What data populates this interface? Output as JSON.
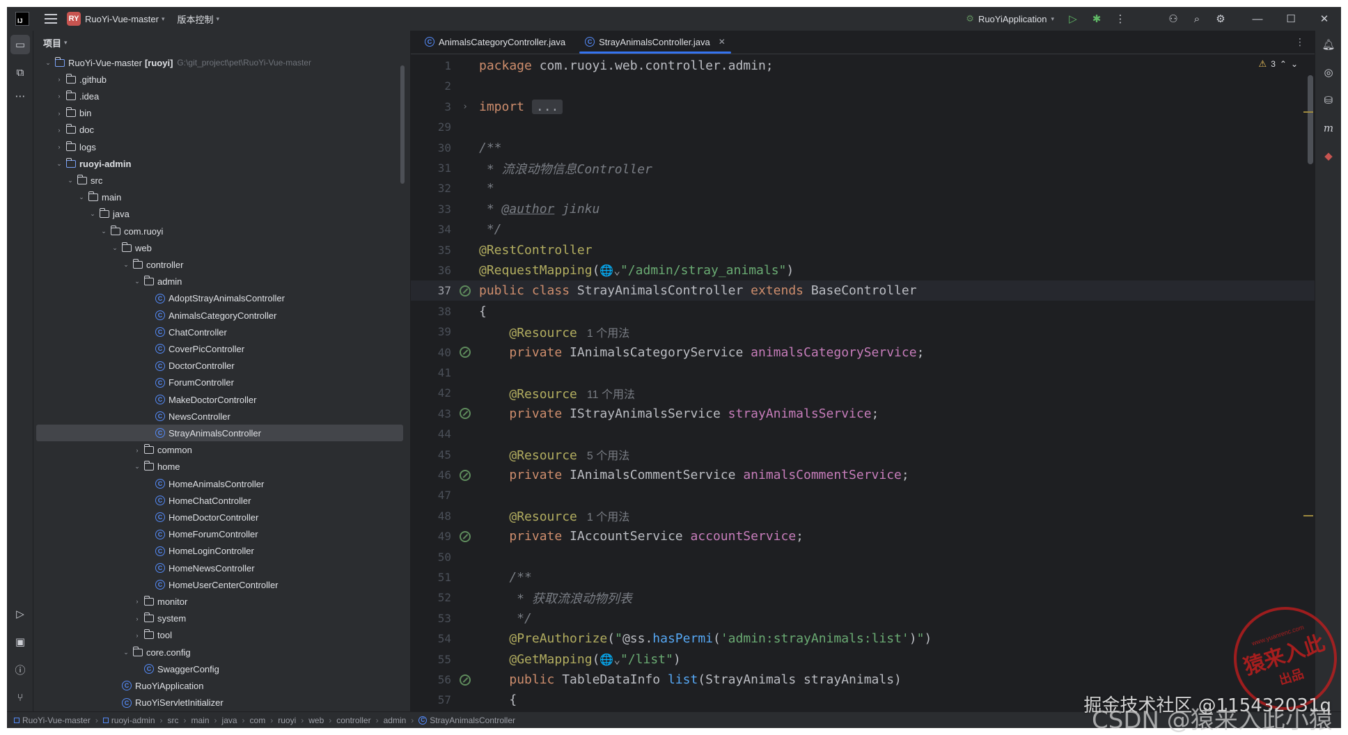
{
  "titlebar": {
    "project_badge": "RY",
    "project_name": "RuoYi-Vue-master",
    "vcs_label": "版本控制",
    "run_config": "RuoYiApplication"
  },
  "project_panel": {
    "title": "项目",
    "tree": [
      {
        "label": "RuoYi-Vue-master",
        "module": "[ruoyi]",
        "path": "G:\\git_project\\pet\\RuoYi-Vue-master",
        "depth": 0,
        "arrow": "open",
        "kind": "module"
      },
      {
        "label": ".github",
        "depth": 1,
        "arrow": "closed",
        "kind": "folder"
      },
      {
        "label": ".idea",
        "depth": 1,
        "arrow": "closed",
        "kind": "folder"
      },
      {
        "label": "bin",
        "depth": 1,
        "arrow": "closed",
        "kind": "folder"
      },
      {
        "label": "doc",
        "depth": 1,
        "arrow": "closed",
        "kind": "folder"
      },
      {
        "label": "logs",
        "depth": 1,
        "arrow": "closed",
        "kind": "folder"
      },
      {
        "label": "ruoyi-admin",
        "depth": 1,
        "arrow": "open",
        "kind": "module",
        "bold": true
      },
      {
        "label": "src",
        "depth": 2,
        "arrow": "open",
        "kind": "folder"
      },
      {
        "label": "main",
        "depth": 3,
        "arrow": "open",
        "kind": "folder"
      },
      {
        "label": "java",
        "depth": 4,
        "arrow": "open",
        "kind": "folder"
      },
      {
        "label": "com.ruoyi",
        "depth": 5,
        "arrow": "open",
        "kind": "folder"
      },
      {
        "label": "web",
        "depth": 6,
        "arrow": "open",
        "kind": "folder"
      },
      {
        "label": "controller",
        "depth": 7,
        "arrow": "open",
        "kind": "folder"
      },
      {
        "label": "admin",
        "depth": 8,
        "arrow": "open",
        "kind": "folder"
      },
      {
        "label": "AdoptStrayAnimalsController",
        "depth": 9,
        "kind": "class"
      },
      {
        "label": "AnimalsCategoryController",
        "depth": 9,
        "kind": "class"
      },
      {
        "label": "ChatController",
        "depth": 9,
        "kind": "class"
      },
      {
        "label": "CoverPicController",
        "depth": 9,
        "kind": "class"
      },
      {
        "label": "DoctorController",
        "depth": 9,
        "kind": "class"
      },
      {
        "label": "ForumController",
        "depth": 9,
        "kind": "class"
      },
      {
        "label": "MakeDoctorController",
        "depth": 9,
        "kind": "class"
      },
      {
        "label": "NewsController",
        "depth": 9,
        "kind": "class"
      },
      {
        "label": "StrayAnimalsController",
        "depth": 9,
        "kind": "class",
        "selected": true
      },
      {
        "label": "common",
        "depth": 8,
        "arrow": "closed",
        "kind": "folder"
      },
      {
        "label": "home",
        "depth": 8,
        "arrow": "open",
        "kind": "folder"
      },
      {
        "label": "HomeAnimalsController",
        "depth": 9,
        "kind": "class"
      },
      {
        "label": "HomeChatController",
        "depth": 9,
        "kind": "class"
      },
      {
        "label": "HomeDoctorController",
        "depth": 9,
        "kind": "class"
      },
      {
        "label": "HomeForumController",
        "depth": 9,
        "kind": "class"
      },
      {
        "label": "HomeLoginController",
        "depth": 9,
        "kind": "class"
      },
      {
        "label": "HomeNewsController",
        "depth": 9,
        "kind": "class"
      },
      {
        "label": "HomeUserCenterController",
        "depth": 9,
        "kind": "class"
      },
      {
        "label": "monitor",
        "depth": 8,
        "arrow": "closed",
        "kind": "folder"
      },
      {
        "label": "system",
        "depth": 8,
        "arrow": "closed",
        "kind": "folder"
      },
      {
        "label": "tool",
        "depth": 8,
        "arrow": "closed",
        "kind": "folder"
      },
      {
        "label": "core.config",
        "depth": 7,
        "arrow": "open",
        "kind": "folder"
      },
      {
        "label": "SwaggerConfig",
        "depth": 8,
        "kind": "class"
      },
      {
        "label": "RuoYiApplication",
        "depth": 6,
        "kind": "class"
      },
      {
        "label": "RuoYiServletInitializer",
        "depth": 6,
        "kind": "class"
      }
    ]
  },
  "editor": {
    "tabs": [
      {
        "label": "AnimalsCategoryController.java",
        "active": false
      },
      {
        "label": "StrayAnimalsController.java",
        "active": true
      }
    ],
    "warning_count": "3",
    "current_line": 37,
    "lines": [
      {
        "n": "1",
        "tokens": [
          [
            "kw",
            "package"
          ],
          [
            "t",
            " com.ruoyi.web.controller.admin;"
          ]
        ]
      },
      {
        "n": "2",
        "tokens": []
      },
      {
        "n": "3",
        "fold": true,
        "tokens": [
          [
            "kw",
            "import"
          ],
          [
            "t",
            " "
          ],
          [
            "fold",
            "..."
          ]
        ]
      },
      {
        "n": "29",
        "tokens": []
      },
      {
        "n": "30",
        "tokens": [
          [
            "cmt",
            "/**"
          ]
        ]
      },
      {
        "n": "31",
        "tokens": [
          [
            "cmt",
            " * 流浪动物信息Controller"
          ]
        ]
      },
      {
        "n": "32",
        "tokens": [
          [
            "cmt",
            " *"
          ]
        ]
      },
      {
        "n": "33",
        "tokens": [
          [
            "cmt",
            " * "
          ],
          [
            "doctag",
            "@author"
          ],
          [
            "cmt",
            " jinku"
          ]
        ]
      },
      {
        "n": "34",
        "tokens": [
          [
            "cmt",
            " */"
          ]
        ]
      },
      {
        "n": "35",
        "tokens": [
          [
            "ann",
            "@RestController"
          ]
        ]
      },
      {
        "n": "36",
        "tokens": [
          [
            "ann",
            "@RequestMapping"
          ],
          [
            "t",
            "("
          ],
          [
            "globe",
            "🌐⌄"
          ],
          [
            "str",
            "\"/admin/stray_animals\""
          ],
          [
            "t",
            ")"
          ]
        ]
      },
      {
        "n": "37",
        "gutter": true,
        "tokens": [
          [
            "kw",
            "public class "
          ],
          [
            "t",
            "StrayAnimalsController "
          ],
          [
            "kw",
            "extends "
          ],
          [
            "t",
            "BaseController"
          ]
        ]
      },
      {
        "n": "38",
        "tokens": [
          [
            "t",
            "{"
          ]
        ]
      },
      {
        "n": "39",
        "tokens": [
          [
            "t",
            "    "
          ],
          [
            "ann",
            "@Resource"
          ],
          [
            "hint",
            "1 个用法"
          ]
        ]
      },
      {
        "n": "40",
        "gutter": true,
        "tokens": [
          [
            "t",
            "    "
          ],
          [
            "kw",
            "private "
          ],
          [
            "t",
            "IAnimalsCategoryService "
          ],
          [
            "fld",
            "animalsCategoryService"
          ],
          [
            "t",
            ";"
          ]
        ]
      },
      {
        "n": "41",
        "tokens": []
      },
      {
        "n": "42",
        "tokens": [
          [
            "t",
            "    "
          ],
          [
            "ann",
            "@Resource"
          ],
          [
            "hint",
            "11 个用法"
          ]
        ]
      },
      {
        "n": "43",
        "gutter": true,
        "tokens": [
          [
            "t",
            "    "
          ],
          [
            "kw",
            "private "
          ],
          [
            "t",
            "IStrayAnimalsService "
          ],
          [
            "fld",
            "strayAnimalsService"
          ],
          [
            "t",
            ";"
          ]
        ]
      },
      {
        "n": "44",
        "tokens": []
      },
      {
        "n": "45",
        "tokens": [
          [
            "t",
            "    "
          ],
          [
            "ann",
            "@Resource"
          ],
          [
            "hint",
            "5 个用法"
          ]
        ]
      },
      {
        "n": "46",
        "gutter": true,
        "tokens": [
          [
            "t",
            "    "
          ],
          [
            "kw",
            "private "
          ],
          [
            "t",
            "IAnimalsCommentService "
          ],
          [
            "fld",
            "animalsCommentService"
          ],
          [
            "t",
            ";"
          ]
        ]
      },
      {
        "n": "47",
        "tokens": []
      },
      {
        "n": "48",
        "tokens": [
          [
            "t",
            "    "
          ],
          [
            "ann",
            "@Resource"
          ],
          [
            "hint",
            "1 个用法"
          ]
        ]
      },
      {
        "n": "49",
        "gutter": true,
        "tokens": [
          [
            "t",
            "    "
          ],
          [
            "kw",
            "private "
          ],
          [
            "t",
            "IAccountService "
          ],
          [
            "fld",
            "accountService"
          ],
          [
            "t",
            ";"
          ]
        ]
      },
      {
        "n": "50",
        "tokens": []
      },
      {
        "n": "51",
        "tokens": [
          [
            "cmt",
            "    /**"
          ]
        ]
      },
      {
        "n": "52",
        "tokens": [
          [
            "cmt",
            "     * 获取流浪动物列表"
          ]
        ]
      },
      {
        "n": "53",
        "tokens": [
          [
            "cmt",
            "     */"
          ]
        ]
      },
      {
        "n": "54",
        "tokens": [
          [
            "t",
            "    "
          ],
          [
            "ann",
            "@PreAuthorize"
          ],
          [
            "t",
            "("
          ],
          [
            "str",
            "\""
          ],
          [
            "t",
            "@ss."
          ],
          [
            "mth",
            "hasPermi"
          ],
          [
            "t",
            "("
          ],
          [
            "str",
            "'admin:strayAnimals:list'"
          ],
          [
            "t",
            ")"
          ],
          [
            "str",
            "\""
          ],
          [
            "t",
            ")"
          ]
        ]
      },
      {
        "n": "55",
        "tokens": [
          [
            "t",
            "    "
          ],
          [
            "ann",
            "@GetMapping"
          ],
          [
            "t",
            "("
          ],
          [
            "globe",
            "🌐⌄"
          ],
          [
            "str",
            "\"/list\""
          ],
          [
            "t",
            ")"
          ]
        ]
      },
      {
        "n": "56",
        "gutter": "web",
        "tokens": [
          [
            "t",
            "    "
          ],
          [
            "kw",
            "public "
          ],
          [
            "t",
            "TableDataInfo "
          ],
          [
            "mth",
            "list"
          ],
          [
            "t",
            "(StrayAnimals strayAnimals)"
          ]
        ]
      },
      {
        "n": "57",
        "tokens": [
          [
            "t",
            "    {"
          ]
        ]
      }
    ]
  },
  "breadcrumb": [
    "RuoYi-Vue-master",
    "ruoyi-admin",
    "src",
    "main",
    "java",
    "com",
    "ruoyi",
    "web",
    "controller",
    "admin",
    "StrayAnimalsController"
  ],
  "watermarks": {
    "stamp_top": "www.yuanrenc.com",
    "stamp_main": "猿来入此",
    "stamp_bottom": "出品",
    "csdn": "掘金技术社区 @115432031q",
    "csdn2": "CSDN @猿来入此小猿"
  }
}
